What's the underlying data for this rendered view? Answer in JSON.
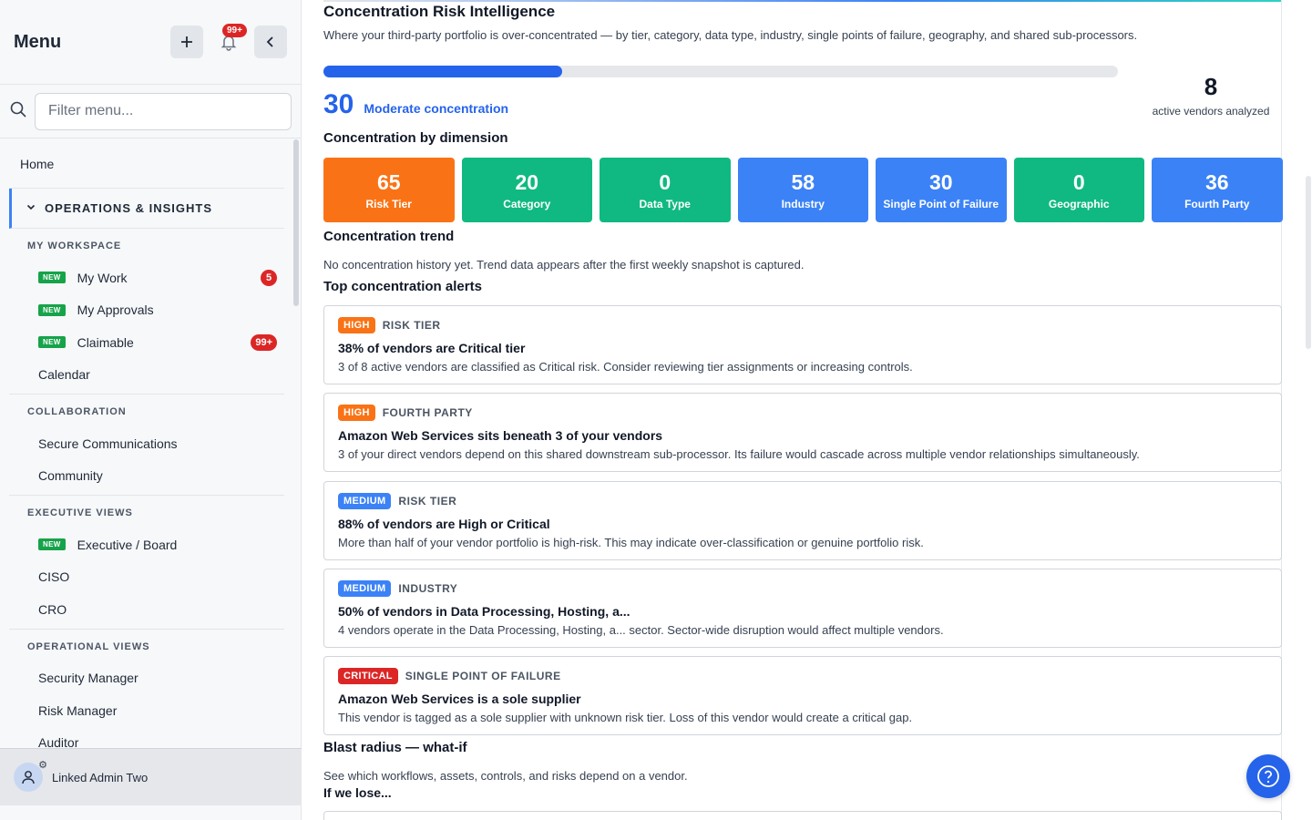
{
  "sidebar": {
    "title": "Menu",
    "notifications_badge": "99+",
    "search_placeholder": "Filter menu...",
    "home": "Home",
    "section": "OPERATIONS & INSIGHTS",
    "groups": [
      {
        "label": "MY WORKSPACE",
        "items": [
          {
            "label": "My Work",
            "new": "NEW",
            "count": "5"
          },
          {
            "label": "My Approvals",
            "new": "NEW"
          },
          {
            "label": "Claimable",
            "new": "NEW",
            "count": "99+"
          },
          {
            "label": "Calendar"
          }
        ]
      },
      {
        "label": "COLLABORATION",
        "items": [
          {
            "label": "Secure Communications"
          },
          {
            "label": "Community"
          }
        ]
      },
      {
        "label": "EXECUTIVE VIEWS",
        "items": [
          {
            "label": "Executive / Board",
            "new": "NEW"
          },
          {
            "label": "CISO"
          },
          {
            "label": "CRO"
          }
        ]
      },
      {
        "label": "OPERATIONAL VIEWS",
        "items": [
          {
            "label": "Security Manager"
          },
          {
            "label": "Risk Manager"
          },
          {
            "label": "Auditor"
          }
        ]
      }
    ],
    "user": "Linked Admin Two"
  },
  "main": {
    "title": "Concentration Risk Intelligence",
    "subtitle": "Where your third-party portfolio is over-concentrated — by tier, category, data type, industry, single points of failure, geography, and shared sub-processors.",
    "score": "30",
    "score_value": 30,
    "score_label": "Moderate concentration",
    "vendor_count": "8",
    "vendor_label": "active vendors analyzed",
    "dimension_heading": "Concentration by dimension",
    "dimensions": [
      {
        "value": "65",
        "label": "Risk Tier",
        "color": "#f97316"
      },
      {
        "value": "20",
        "label": "Category",
        "color": "#10b981"
      },
      {
        "value": "0",
        "label": "Data Type",
        "color": "#10b981"
      },
      {
        "value": "58",
        "label": "Industry",
        "color": "#3b82f6"
      },
      {
        "value": "30",
        "label": "Single Point of Failure",
        "color": "#3b82f6"
      },
      {
        "value": "0",
        "label": "Geographic",
        "color": "#10b981"
      },
      {
        "value": "36",
        "label": "Fourth Party",
        "color": "#3b82f6"
      }
    ],
    "trend_heading": "Concentration trend",
    "trend_text": "No concentration history yet. Trend data appears after the first weekly snapshot is captured.",
    "alerts_heading": "Top concentration alerts",
    "alerts": [
      {
        "severity": "HIGH",
        "sev_color": "#f97316",
        "category": "RISK TIER",
        "title": "38% of vendors are Critical tier",
        "desc": "3 of 8 active vendors are classified as Critical risk. Consider reviewing tier assignments or increasing controls."
      },
      {
        "severity": "HIGH",
        "sev_color": "#f97316",
        "category": "FOURTH PARTY",
        "title": "Amazon Web Services sits beneath 3 of your vendors",
        "desc": "3 of your direct vendors depend on this shared downstream sub-processor. Its failure would cascade across multiple vendor relationships simultaneously."
      },
      {
        "severity": "MEDIUM",
        "sev_color": "#3b82f6",
        "category": "RISK TIER",
        "title": "88% of vendors are High or Critical",
        "desc": "More than half of your vendor portfolio is high-risk. This may indicate over-classification or genuine portfolio risk."
      },
      {
        "severity": "MEDIUM",
        "sev_color": "#3b82f6",
        "category": "INDUSTRY",
        "title": "50% of vendors in Data Processing, Hosting, a...",
        "desc": "4 vendors operate in the Data Processing, Hosting, a... sector. Sector-wide disruption would affect multiple vendors."
      },
      {
        "severity": "CRITICAL",
        "sev_color": "#dc2626",
        "category": "SINGLE POINT OF FAILURE",
        "title": "Amazon Web Services is a sole supplier",
        "desc": "This vendor is tagged as a sole supplier with unknown risk tier. Loss of this vendor would create a critical gap."
      }
    ],
    "blast_heading": "Blast radius — what-if",
    "blast_text": "See which workflows, assets, controls, and risks depend on a vendor.",
    "if_we_lose": "If we lose..."
  }
}
